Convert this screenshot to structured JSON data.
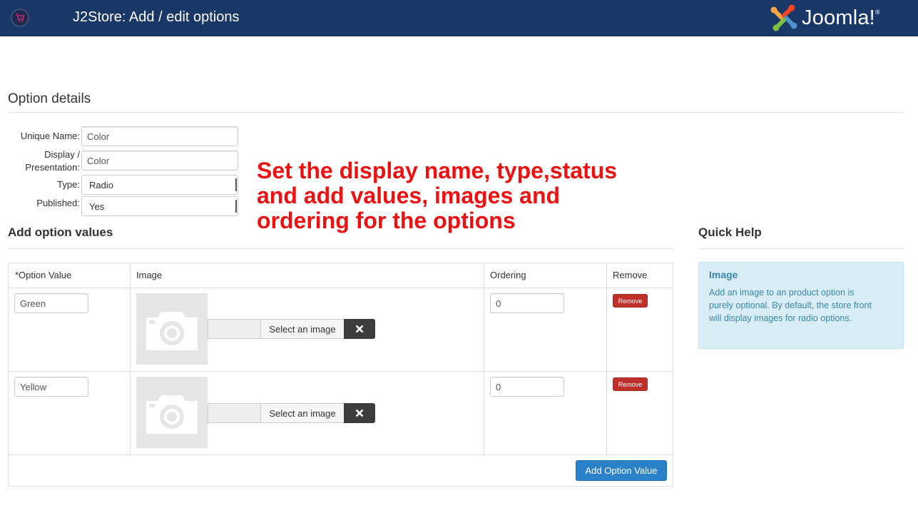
{
  "header": {
    "app_title": "J2Store: Add / edit options",
    "brand": "Joomla!",
    "brand_mark": "®"
  },
  "option_details": {
    "heading": "Option details",
    "unique_name_label": "Unique Name:",
    "unique_name_value": "Color",
    "display_label_line1": "Display /",
    "display_label_line2": "Presentation:",
    "display_value": "Color",
    "type_label": "Type:",
    "type_value": "Radio",
    "published_label": "Published:",
    "published_value": "Yes"
  },
  "annotation": {
    "line1": "Set the display name, type,status",
    "line2": "and add values, images and",
    "line3": "ordering for the options"
  },
  "option_values": {
    "heading": "Add option values",
    "columns": [
      "*Option Value",
      "Image",
      "Ordering",
      "Remove"
    ],
    "rows": [
      {
        "value": "Green",
        "select_image_label": "Select an image",
        "ordering": "0",
        "remove_label": "Remove"
      },
      {
        "value": "Yellow",
        "select_image_label": "Select an image",
        "ordering": "0",
        "remove_label": "Remove"
      }
    ],
    "add_button_label": "Add Option Value"
  },
  "quick_help": {
    "heading": "Quick Help",
    "title": "Image",
    "text": "Add an image to an product option is purely optional. By default, the store front will display images for radio options."
  },
  "icons": {
    "app_icon": "cart-icon",
    "brand_logo": "joomla-logo",
    "image_placeholder": "camera-icon",
    "clear_image": "close-icon"
  },
  "colors": {
    "header_bg": "#1a3867",
    "annotation": "#ee1111",
    "remove_button": "#c0302b",
    "primary_button": "#2a80c9",
    "help_bg": "#d9edf7",
    "help_text": "#3a87ad"
  }
}
